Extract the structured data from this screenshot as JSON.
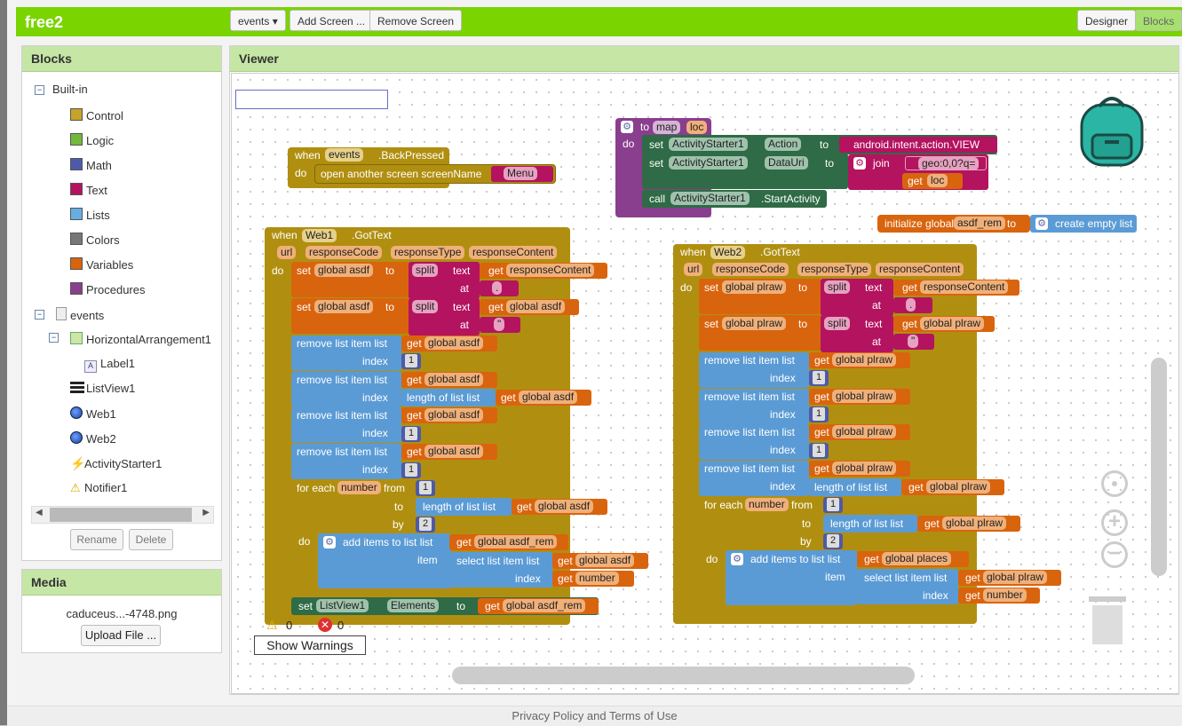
{
  "app": {
    "title": "free2"
  },
  "toolbar": {
    "screen_select": "events ▾",
    "add_screen": "Add Screen ...",
    "remove_screen": "Remove Screen",
    "designer": "Designer",
    "blocks": "Blocks"
  },
  "blocks_panel": {
    "title": "Blocks",
    "builtin": "Built-in",
    "categories": [
      {
        "label": "Control",
        "color": "#c6a32b"
      },
      {
        "label": "Logic",
        "color": "#74b83e"
      },
      {
        "label": "Math",
        "color": "#4e5aa7"
      },
      {
        "label": "Text",
        "color": "#b4135f"
      },
      {
        "label": "Lists",
        "color": "#67aee2"
      },
      {
        "label": "Colors",
        "color": "#777777"
      },
      {
        "label": "Variables",
        "color": "#d9640e"
      },
      {
        "label": "Procedures",
        "color": "#8a3e8e"
      }
    ],
    "screen": "events",
    "components": {
      "harr": "HorizontalArrangement1",
      "label1": "Label1",
      "listview": "ListView1",
      "web1": "Web1",
      "web2": "Web2",
      "activity": "ActivityStarter1",
      "notifier": "Notifier1"
    },
    "rename": "Rename",
    "delete": "Delete"
  },
  "media": {
    "title": "Media",
    "file": "caduceus...-4748.png",
    "upload": "Upload File ..."
  },
  "viewer": {
    "title": "Viewer",
    "search_value": ""
  },
  "warnings": {
    "warn_count": "0",
    "error_count": "0",
    "show": "Show Warnings"
  },
  "footer": {
    "text": "Privacy Policy and Terms of Use"
  },
  "colors": {
    "control": "#b08f10",
    "text": "#b4135f",
    "lists": "#5b9bd5",
    "variables": "#d9640e",
    "procedures": "#8a3e8e",
    "component": "#2f6b46",
    "math": "#4e5aa7"
  },
  "blocks": {
    "backpressed": {
      "when": "when",
      "comp": "events",
      "event": ".BackPressed",
      "do": "do",
      "open": "open another screen  screenName",
      "value": "Menu"
    },
    "proc": {
      "to": "to",
      "name": "map",
      "param": "loc",
      "do": "do",
      "set": "set",
      "comp": "ActivityStarter1",
      "prop1": "Action",
      "to2": "to",
      "action": "android.intent.action.VIEW",
      "prop2": "DataUri",
      "join": "join",
      "geo": "geo:0,0?q=",
      "get": "get",
      "loc": "loc",
      "call": "call",
      "method": ".StartActivity"
    },
    "initglobal": {
      "label": "initialize global",
      "name": "asdf_rem",
      "to": "to",
      "value": "create empty list"
    },
    "web1": {
      "when": "when",
      "comp": "Web1",
      "event": ".GotText",
      "params": [
        "url",
        "responseCode",
        "responseType",
        "responseContent"
      ],
      "do": "do",
      "set": "set",
      "var": "global asdf",
      "to": "to",
      "split": "split",
      "text": "text",
      "at": "at",
      "get": "get",
      "rc": "responseContent",
      "g_asdf": "global asdf",
      "dot": ".",
      "nl": "\"",
      "remove": "remove list item  list",
      "index": "index",
      "one": "1",
      "length": "length of list  list",
      "foreach": "for each",
      "number": "number",
      "from": "from",
      "tolbl": "to",
      "by": "by",
      "two": "2",
      "additems": "add items to list  list",
      "rem": "global asdf_rem",
      "item": "item",
      "selectitem": "select list item  list",
      "getnum": "number",
      "setlv": "set",
      "lv": "ListView1",
      "elements": "Elements"
    },
    "web2": {
      "when": "when",
      "comp": "Web2",
      "event": ".GotText",
      "params": [
        "url",
        "responseCode",
        "responseType",
        "responseContent"
      ],
      "do": "do",
      "set": "set",
      "var": "global plraw",
      "to": "to",
      "split": "split",
      "text": "text",
      "at": "at",
      "get": "get",
      "rc": "responseContent",
      "g_plraw": "global plraw",
      "dot": ".",
      "nl": "\"",
      "remove": "remove list item  list",
      "index": "index",
      "one": "1",
      "length": "length of list  list",
      "foreach": "for each",
      "number": "number",
      "from": "from",
      "tolbl": "to",
      "by": "by",
      "two": "2",
      "additems": "add items to list  list",
      "places": "global places",
      "item": "item",
      "selectitem": "select list item  list",
      "getnum": "number"
    }
  }
}
